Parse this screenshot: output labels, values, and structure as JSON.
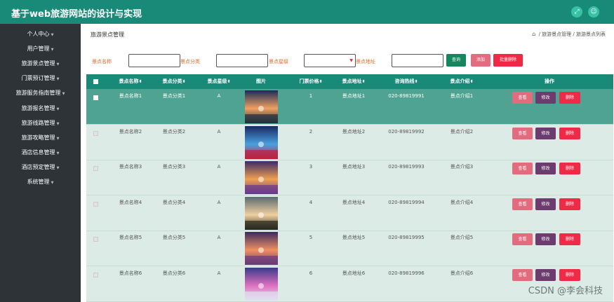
{
  "app": {
    "title": "基于web旅游网站的设计与实现"
  },
  "topbar": {
    "icon_expand": "⤢",
    "icon_user": "☺"
  },
  "sidebar": {
    "items": [
      {
        "label": "个人中心",
        "caret": true
      },
      {
        "label": "用户管理",
        "caret": true
      },
      {
        "label": "旅游景点管理",
        "caret": true
      },
      {
        "label": "门票预订管理",
        "caret": true
      },
      {
        "label": "旅游服务指南管理",
        "caret": true
      },
      {
        "label": "旅游报名管理",
        "caret": true
      },
      {
        "label": "旅游线路管理",
        "caret": true
      },
      {
        "label": "旅游攻略管理",
        "caret": true
      },
      {
        "label": "酒店信息管理",
        "caret": true
      },
      {
        "label": "酒店预定管理",
        "caret": true
      },
      {
        "label": "系统管理",
        "caret": true
      }
    ]
  },
  "page": {
    "title": "旅游景点管理",
    "breadcrumb": {
      "home_icon": "⌂",
      "first": "旅游景点管理",
      "separator": "/",
      "second": "旅游景点列表"
    }
  },
  "filters": {
    "name_label": "景点名称",
    "category_label": "景点分类",
    "rating_label": "景点星级",
    "address_label": "景点地址",
    "name_value": "",
    "category_value": "",
    "address_value": "",
    "search_button": "查询",
    "add_button": "添加",
    "batch_delete_button": "批量删除"
  },
  "table": {
    "headers": [
      "景点名称",
      "景点分类",
      "景点星级",
      "图片",
      "门票价格",
      "景点地址",
      "咨询热线",
      "景点介绍",
      "操作"
    ],
    "sort_headers": [
      "景点名称",
      "景点分类",
      "景点星级",
      "门票价格",
      "景点地址",
      "咨询热线",
      "景点介绍"
    ],
    "action_labels": {
      "view": "查看",
      "edit": "修改",
      "delete": "删除"
    },
    "rows": [
      {
        "name": "景点名称1",
        "category": "景点分类1",
        "rating": "A",
        "price": "1",
        "address": "景点地址1",
        "phone": "020-89819991",
        "intro": "景点介绍1",
        "selected": true
      },
      {
        "name": "景点名称2",
        "category": "景点分类2",
        "rating": "A",
        "price": "2",
        "address": "景点地址2",
        "phone": "020-89819992",
        "intro": "景点介绍2",
        "selected": false
      },
      {
        "name": "景点名称3",
        "category": "景点分类3",
        "rating": "A",
        "price": "3",
        "address": "景点地址3",
        "phone": "020-89819993",
        "intro": "景点介绍3",
        "selected": false
      },
      {
        "name": "景点名称4",
        "category": "景点分类4",
        "rating": "A",
        "price": "4",
        "address": "景点地址4",
        "phone": "020-89819994",
        "intro": "景点介绍4",
        "selected": false
      },
      {
        "name": "景点名称5",
        "category": "景点分类5",
        "rating": "A",
        "price": "5",
        "address": "景点地址5",
        "phone": "020-89819995",
        "intro": "景点介绍5",
        "selected": false
      },
      {
        "name": "景点名称6",
        "category": "景点分类6",
        "rating": "A",
        "price": "6",
        "address": "景点地址6",
        "phone": "020-89819996",
        "intro": "景点介绍6",
        "selected": false
      }
    ]
  },
  "watermark": "CSDN @李会科技",
  "colors": {
    "primary": "#1a8a78",
    "sidebar": "#2e3337",
    "selected_row": "#4fa392",
    "row_bg": "#dcebe6",
    "filter_label": "#e06a2a",
    "view": "#e36b7e",
    "edit": "#6d3c6e",
    "delete": "#ee2a46",
    "search": "#15875f",
    "add": "#e56b7e",
    "batch_delete": "#ee2a46"
  }
}
